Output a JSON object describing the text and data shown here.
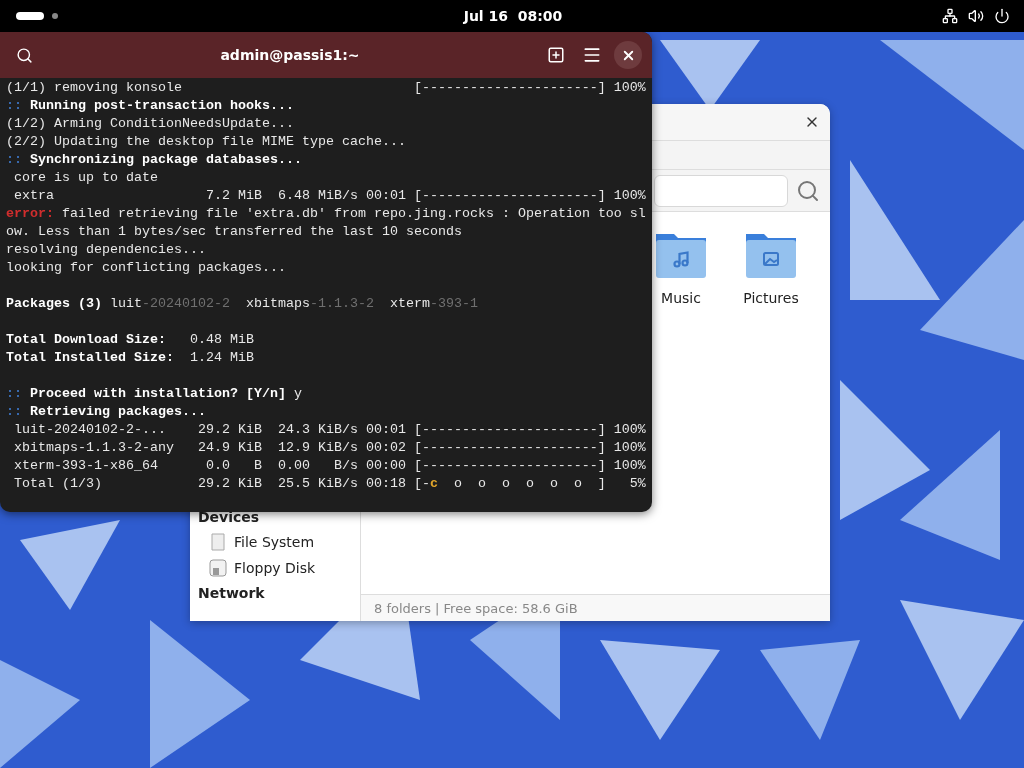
{
  "top_bar": {
    "clock": "Jul 16  08:00"
  },
  "terminal": {
    "title": "admin@passis1:~",
    "lines": [
      {
        "kind": "text",
        "segments": [
          {
            "text": "(1/1) removing konsole                             [----------------------] 100%",
            "kind": "plain"
          }
        ]
      },
      {
        "kind": "text",
        "segments": [
          {
            "text": "::",
            "kind": "marker"
          },
          {
            "text": " Running post-transaction hooks...",
            "kind": "bold"
          }
        ]
      },
      {
        "kind": "text",
        "segments": [
          {
            "text": "(1/2) Arming ConditionNeedsUpdate...",
            "kind": "plain"
          }
        ]
      },
      {
        "kind": "text",
        "segments": [
          {
            "text": "(2/2) Updating the desktop file MIME type cache...",
            "kind": "plain"
          }
        ]
      },
      {
        "kind": "text",
        "segments": [
          {
            "text": "::",
            "kind": "marker"
          },
          {
            "text": " Synchronizing package databases...",
            "kind": "bold"
          }
        ]
      },
      {
        "kind": "text",
        "segments": [
          {
            "text": " core is up to date",
            "kind": "plain"
          }
        ]
      },
      {
        "kind": "text",
        "segments": [
          {
            "text": " extra                   7.2 MiB  6.48 MiB/s 00:01 [----------------------] 100%",
            "kind": "plain"
          }
        ]
      },
      {
        "kind": "text",
        "segments": [
          {
            "text": "error:",
            "kind": "error"
          },
          {
            "text": " failed retrieving file 'extra.db' from repo.jing.rocks : Operation too sl",
            "kind": "plain"
          }
        ]
      },
      {
        "kind": "text",
        "segments": [
          {
            "text": "ow. Less than 1 bytes/sec transferred the last 10 seconds",
            "kind": "plain"
          }
        ]
      },
      {
        "kind": "text",
        "segments": [
          {
            "text": "resolving dependencies...",
            "kind": "plain"
          }
        ]
      },
      {
        "kind": "text",
        "segments": [
          {
            "text": "looking for conflicting packages...",
            "kind": "plain"
          }
        ]
      },
      {
        "kind": "blank"
      },
      {
        "kind": "text",
        "segments": [
          {
            "text": "Packages (3)",
            "kind": "bold"
          },
          {
            "text": " luit",
            "kind": "plain"
          },
          {
            "text": "-20240102-2",
            "kind": "dim"
          },
          {
            "text": "  xbitmaps",
            "kind": "plain"
          },
          {
            "text": "-1.1.3-2",
            "kind": "dim"
          },
          {
            "text": "  xterm",
            "kind": "plain"
          },
          {
            "text": "-393-1",
            "kind": "dim"
          }
        ]
      },
      {
        "kind": "blank"
      },
      {
        "kind": "text",
        "segments": [
          {
            "text": "Total Download Size:",
            "kind": "bold"
          },
          {
            "text": "   0.48 MiB",
            "kind": "plain"
          }
        ]
      },
      {
        "kind": "text",
        "segments": [
          {
            "text": "Total Installed Size:",
            "kind": "bold"
          },
          {
            "text": "  1.24 MiB",
            "kind": "plain"
          }
        ]
      },
      {
        "kind": "blank"
      },
      {
        "kind": "text",
        "segments": [
          {
            "text": "::",
            "kind": "marker"
          },
          {
            "text": " Proceed with installation? [Y/n]",
            "kind": "bold"
          },
          {
            "text": " y",
            "kind": "plain"
          }
        ]
      },
      {
        "kind": "text",
        "segments": [
          {
            "text": "::",
            "kind": "marker"
          },
          {
            "text": " Retrieving packages...",
            "kind": "bold"
          }
        ]
      },
      {
        "kind": "text",
        "segments": [
          {
            "text": " luit-20240102-2-...    29.2 KiB  24.3 KiB/s 00:01 [----------------------] 100%",
            "kind": "plain"
          }
        ]
      },
      {
        "kind": "text",
        "segments": [
          {
            "text": " xbitmaps-1.1.3-2-any   24.9 KiB  12.9 KiB/s 00:02 [----------------------] 100%",
            "kind": "plain"
          }
        ]
      },
      {
        "kind": "text",
        "segments": [
          {
            "text": " xterm-393-1-x86_64      0.0   B  0.00   B/s 00:00 [----------------------] 100%",
            "kind": "plain"
          }
        ]
      },
      {
        "kind": "text",
        "segments": [
          {
            "text": " Total (1/3)            29.2 KiB  25.5 KiB/s 00:18 [-",
            "kind": "plain"
          },
          {
            "text": "c",
            "kind": "accent"
          },
          {
            "text": "  o  o  o  o  o  o  ]   5%",
            "kind": "plain"
          }
        ]
      }
    ]
  },
  "file_manager": {
    "sidebar": [
      {
        "heading": "Devices",
        "items": [
          {
            "label": "File System",
            "kind": "drive"
          },
          {
            "label": "Floppy Disk",
            "kind": "floppy"
          }
        ]
      },
      {
        "heading": "Network"
      }
    ],
    "folders": [
      {
        "name": "Music",
        "kind": "music"
      },
      {
        "name": "Pictures",
        "kind": "pictures"
      }
    ],
    "status": "8 folders | Free space: 58.6 GiB"
  }
}
